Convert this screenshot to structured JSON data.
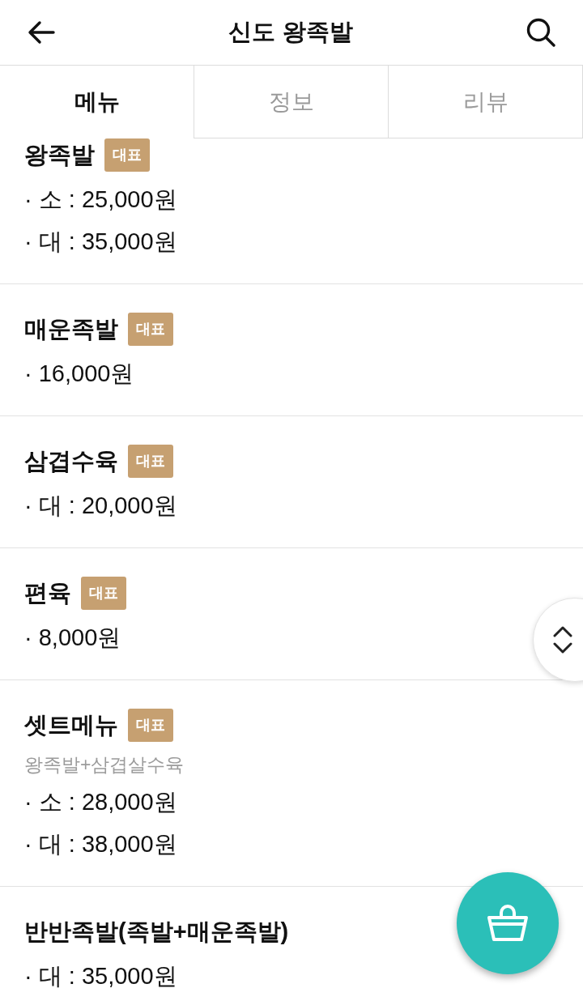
{
  "header": {
    "title": "신도 왕족발"
  },
  "tabs": [
    {
      "label": "메뉴",
      "selected": true
    },
    {
      "label": "정보",
      "selected": false
    },
    {
      "label": "리뷰",
      "selected": false
    }
  ],
  "menu_items": [
    {
      "name": "왕족발",
      "badge": "대표",
      "prices": [
        "· 소 : 25,000원",
        "· 대 : 35,000원"
      ]
    },
    {
      "name": "매운족발",
      "badge": "대표",
      "prices": [
        "· 16,000원"
      ]
    },
    {
      "name": "삼겹수육",
      "badge": "대표",
      "prices": [
        "· 대 : 20,000원"
      ]
    },
    {
      "name": "편육",
      "badge": "대표",
      "prices": [
        "· 8,000원"
      ]
    },
    {
      "name": "셋트메뉴",
      "badge": "대표",
      "description": "왕족발+삼겹살수육",
      "prices": [
        "· 소 : 28,000원",
        "· 대 : 38,000원"
      ]
    },
    {
      "name": "반반족발(족발+매운족발)",
      "prices": [
        "· 대 : 35,000원"
      ]
    }
  ]
}
